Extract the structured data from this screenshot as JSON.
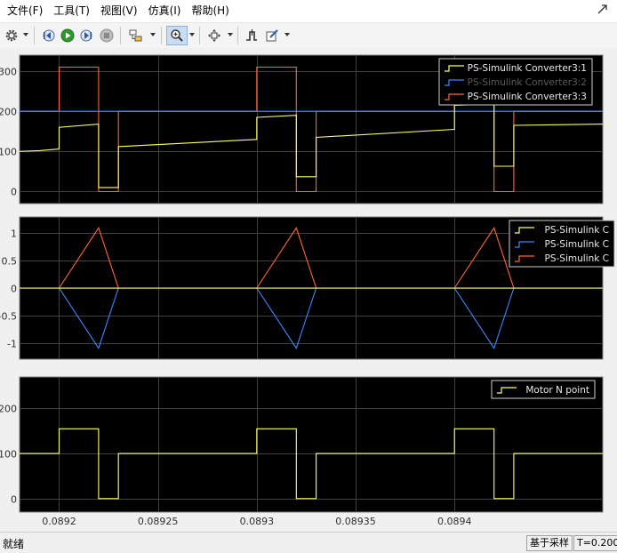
{
  "menu": [
    {
      "label": "文件(F)",
      "name": "menu-file"
    },
    {
      "label": "工具(T)",
      "name": "menu-tools"
    },
    {
      "label": "视图(V)",
      "name": "menu-view"
    },
    {
      "label": "仿真(I)",
      "name": "menu-simulation"
    },
    {
      "label": "帮助(H)",
      "name": "menu-help"
    }
  ],
  "toolbar": {
    "icons": [
      "settings-icon",
      "step-back-icon",
      "run-icon",
      "step-forward-icon",
      "stop-icon",
      "highlight-simulink-block-icon",
      "zoom-in-icon",
      "fit-to-view-icon",
      "triggers-icon",
      "style-icon"
    ]
  },
  "status": {
    "text": "就绪",
    "sample_mode": "基于采样",
    "time": "T=0.200"
  },
  "colors": {
    "background": "#000000",
    "grid": "#404040",
    "axis_text": "#d0d0d0",
    "series_yellow": "#ffff66",
    "series_blue": "#3a8aff",
    "series_orange": "#ff6633"
  },
  "chart_data": [
    {
      "type": "line",
      "title": "",
      "xlabel": "",
      "ylabel": "",
      "xlim": [
        0.08918,
        0.089475
      ],
      "ylim": [
        -30,
        340
      ],
      "yticks": [
        0,
        100,
        200,
        300
      ],
      "grid": true,
      "legend_position": "top-right",
      "series": [
        {
          "name": "PS-Simulink Converter3:1",
          "color": "#ffff66",
          "x": [
            0.08918,
            0.08919,
            0.0892,
            0.0892,
            0.08922,
            0.08922,
            0.08923,
            0.08923,
            0.0893,
            0.0893,
            0.08932,
            0.08932,
            0.08933,
            0.08933,
            0.0894,
            0.0894,
            0.08942,
            0.08942,
            0.08943,
            0.08943,
            0.089475
          ],
          "y": [
            100,
            102,
            106,
            160,
            168,
            10,
            10,
            112,
            130,
            185,
            190,
            37,
            37,
            135,
            155,
            215,
            218,
            63,
            63,
            165,
            168
          ]
        },
        {
          "name": "PS-Simulink Converter3:2",
          "color": "#3a8aff",
          "x": [
            0.08918,
            0.089475
          ],
          "y": [
            200,
            200
          ]
        },
        {
          "name": "PS-Simulink Converter3:3",
          "color": "#ff6633",
          "x": [
            0.08918,
            0.0892,
            0.0892,
            0.08922,
            0.08922,
            0.08923,
            0.08923,
            0.0893,
            0.0893,
            0.08932,
            0.08932,
            0.08933,
            0.08933,
            0.0894,
            0.0894,
            0.08942,
            0.08942,
            0.08943,
            0.08943,
            0.089475
          ],
          "y": [
            200,
            200,
            310,
            310,
            0,
            0,
            200,
            200,
            310,
            310,
            0,
            0,
            200,
            200,
            310,
            310,
            0,
            0,
            200,
            200
          ]
        }
      ]
    },
    {
      "type": "line",
      "title": "",
      "xlabel": "",
      "ylabel": "",
      "xlim": [
        0.08918,
        0.089475
      ],
      "ylim": [
        -1.3,
        1.3
      ],
      "yticks": [
        -1,
        -0.5,
        0,
        0.5,
        1
      ],
      "grid": true,
      "legend_position": "top-right",
      "series": [
        {
          "name": "PS-Simulink C",
          "color": "#ffff66",
          "x": [
            0.08918,
            0.089475
          ],
          "y": [
            0,
            0
          ]
        },
        {
          "name": "PS-Simulink C",
          "color": "#3a8aff",
          "x": [
            0.08918,
            0.0892,
            0.08922,
            0.08923,
            0.08923,
            0.0893,
            0.08932,
            0.08933,
            0.08933,
            0.0894,
            0.08942,
            0.08943,
            0.08943,
            0.089475
          ],
          "y": [
            0,
            0,
            -1.1,
            0,
            0,
            0,
            -1.1,
            0,
            0,
            0,
            -1.1,
            0,
            0,
            0
          ]
        },
        {
          "name": "PS-Simulink C",
          "color": "#ff6633",
          "x": [
            0.08918,
            0.0892,
            0.08922,
            0.08923,
            0.08923,
            0.0893,
            0.08932,
            0.08933,
            0.08933,
            0.0894,
            0.08942,
            0.08943,
            0.08943,
            0.089475
          ],
          "y": [
            0,
            0,
            1.1,
            0,
            0,
            0,
            1.1,
            0,
            0,
            0,
            1.1,
            0,
            0,
            0
          ]
        }
      ]
    },
    {
      "type": "line",
      "title": "",
      "xlabel": "",
      "ylabel": "",
      "xlim": [
        0.08918,
        0.089475
      ],
      "xticks": [
        0.0892,
        0.08925,
        0.0893,
        0.08935,
        0.0894
      ],
      "ylim": [
        -30,
        270
      ],
      "yticks": [
        0,
        100,
        200
      ],
      "grid": true,
      "legend_position": "top-right",
      "series": [
        {
          "name": "Motor N point",
          "color": "#ffff66",
          "x": [
            0.08918,
            0.0892,
            0.0892,
            0.08922,
            0.08922,
            0.08923,
            0.08923,
            0.0893,
            0.0893,
            0.08932,
            0.08932,
            0.08933,
            0.08933,
            0.0894,
            0.0894,
            0.08942,
            0.08942,
            0.08943,
            0.08943,
            0.089475
          ],
          "y": [
            100,
            100,
            155,
            155,
            0,
            0,
            100,
            100,
            155,
            155,
            0,
            0,
            100,
            100,
            155,
            155,
            0,
            0,
            100,
            100
          ]
        }
      ]
    }
  ]
}
